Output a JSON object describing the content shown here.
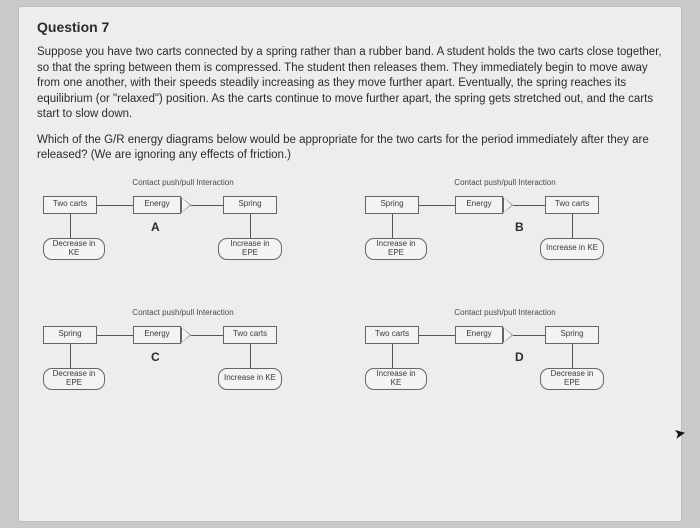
{
  "question_title": "Question 7",
  "prompt1": "Suppose you have two carts connected by a spring rather than a rubber band. A student holds the two carts close together, so that the spring between them is compressed. The student then releases them. They immediately begin to move away from one another, with their speeds steadily increasing as they move further apart. Eventually, the spring reaches its equilibrium (or \"relaxed\") position. As the carts continue to move further apart, the spring gets stretched out, and the carts start to slow down.",
  "prompt2": "Which of the G/R energy diagrams below would be appropriate for the two carts for the period immediately after they are released? (We are ignoring any effects of friction.)",
  "diagrams": {
    "a": {
      "title": "Contact push/pull Interaction",
      "left_obj": "Two carts",
      "mid": "Energy",
      "right_obj": "Spring",
      "left_change": "Decrease in\nKE",
      "right_change": "Increase in\nEPE",
      "letter": "A"
    },
    "b": {
      "title": "Contact push/pull Interaction",
      "left_obj": "Spring",
      "mid": "Energy",
      "right_obj": "Two carts",
      "left_change": "Increase in\nEPE",
      "right_change": "Increase in\nKE",
      "letter": "B"
    },
    "c": {
      "title": "Contact push/pull Interaction",
      "left_obj": "Spring",
      "mid": "Energy",
      "right_obj": "Two carts",
      "left_change": "Decrease in\nEPE",
      "right_change": "Increase in\nKE",
      "letter": "C"
    },
    "d": {
      "title": "Contact push/pull Interaction",
      "left_obj": "Two carts",
      "mid": "Energy",
      "right_obj": "Spring",
      "left_change": "Increase in\nKE",
      "right_change": "Decrease in\nEPE",
      "letter": "D"
    }
  },
  "chart_data": [
    {
      "type": "diagram",
      "id": "A",
      "giver": "Two carts",
      "receiver": "Spring",
      "giver_change": "Decrease in KE",
      "receiver_change": "Increase in EPE",
      "interaction": "Contact push/pull Interaction",
      "flow": "Energy"
    },
    {
      "type": "diagram",
      "id": "B",
      "giver": "Spring",
      "receiver": "Two carts",
      "giver_change": "Increase in EPE",
      "receiver_change": "Increase in KE",
      "interaction": "Contact push/pull Interaction",
      "flow": "Energy"
    },
    {
      "type": "diagram",
      "id": "C",
      "giver": "Spring",
      "receiver": "Two carts",
      "giver_change": "Decrease in EPE",
      "receiver_change": "Increase in KE",
      "interaction": "Contact push/pull Interaction",
      "flow": "Energy"
    },
    {
      "type": "diagram",
      "id": "D",
      "giver": "Two carts",
      "receiver": "Spring",
      "giver_change": "Increase in KE",
      "receiver_change": "Decrease in EPE",
      "interaction": "Contact push/pull Interaction",
      "flow": "Energy"
    }
  ]
}
